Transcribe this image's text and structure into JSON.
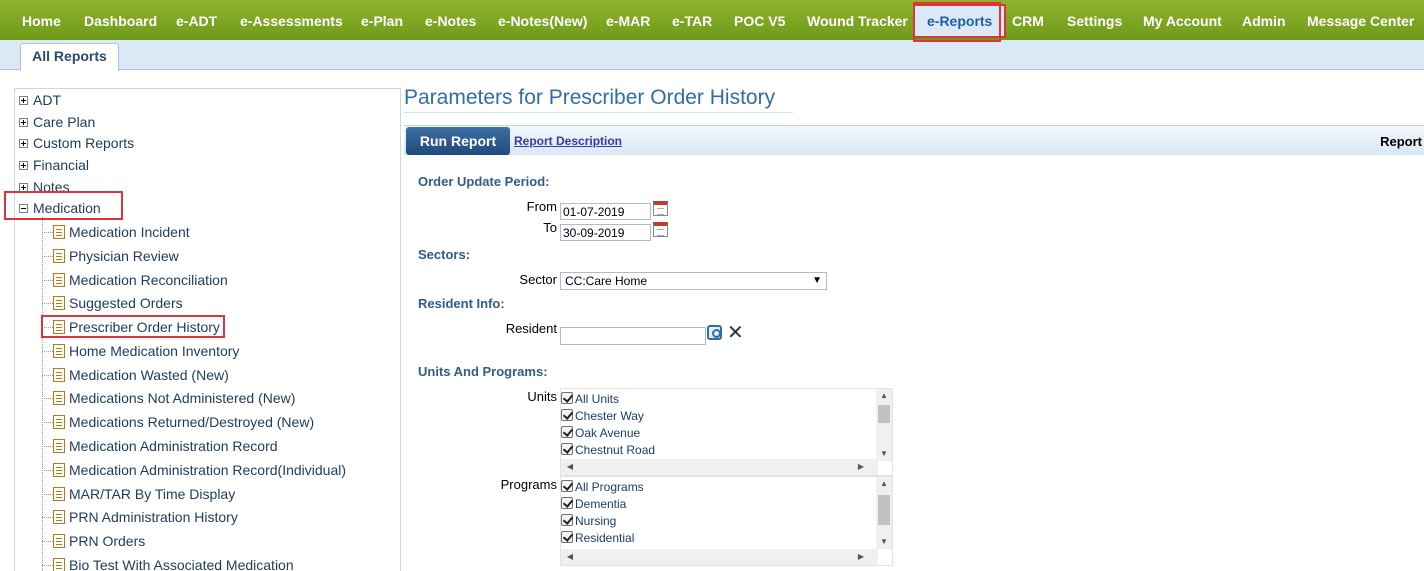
{
  "nav": {
    "items": [
      "Home",
      "Dashboard",
      "e-ADT",
      "e-Assessments",
      "e-Plan",
      "e-Notes",
      "e-Notes(New)",
      "e-MAR",
      "e-TAR",
      "POC V5",
      "Wound Tracker",
      "e-Reports",
      "CRM",
      "Settings",
      "My Account",
      "Admin",
      "Message Center"
    ],
    "active": "e-Reports"
  },
  "subtab": {
    "label": "All Reports"
  },
  "tree": {
    "categories": [
      "ADT",
      "Care Plan",
      "Custom Reports",
      "Financial",
      "Notes",
      "Medication"
    ],
    "expanded": "Medication",
    "medication_reports": [
      "Medication Incident",
      "Physician Review",
      "Medication Reconciliation",
      "Suggested Orders",
      "Prescriber Order History",
      "Home Medication Inventory",
      "Medication Wasted (New)",
      "Medications Not Administered (New)",
      "Medications Returned/Destroyed (New)",
      "Medication Administration Record",
      "Medication Administration Record(Individual)",
      "MAR/TAR By Time Display",
      "PRN Administration History",
      "PRN Orders",
      "Bio Test With Associated Medication"
    ],
    "selected": "Prescriber Order History"
  },
  "panel": {
    "title": "Parameters for Prescriber Order History",
    "run_button": "Run Report",
    "description_link": "Report Description",
    "report_label": "Report",
    "order_period": {
      "heading": "Order Update Period:",
      "from_label": "From",
      "from_value": "01-07-2019",
      "to_label": "To",
      "to_value": "30-09-2019"
    },
    "sectors": {
      "heading": "Sectors:",
      "label": "Sector",
      "value": "CC:Care Home"
    },
    "resident": {
      "heading": "Resident Info:",
      "label": "Resident",
      "value": ""
    },
    "units_programs": {
      "heading": "Units And Programs:",
      "units_label": "Units",
      "units": [
        "All Units",
        "Chester Way",
        "Oak Avenue",
        "Chestnut Road"
      ],
      "programs_label": "Programs",
      "programs": [
        "All Programs",
        "Dementia",
        "Nursing",
        "Residential"
      ]
    }
  },
  "colors": {
    "nav_bg": "#7ea526",
    "accent_blue": "#2f6fa8",
    "highlight_red": "#e0343a"
  }
}
